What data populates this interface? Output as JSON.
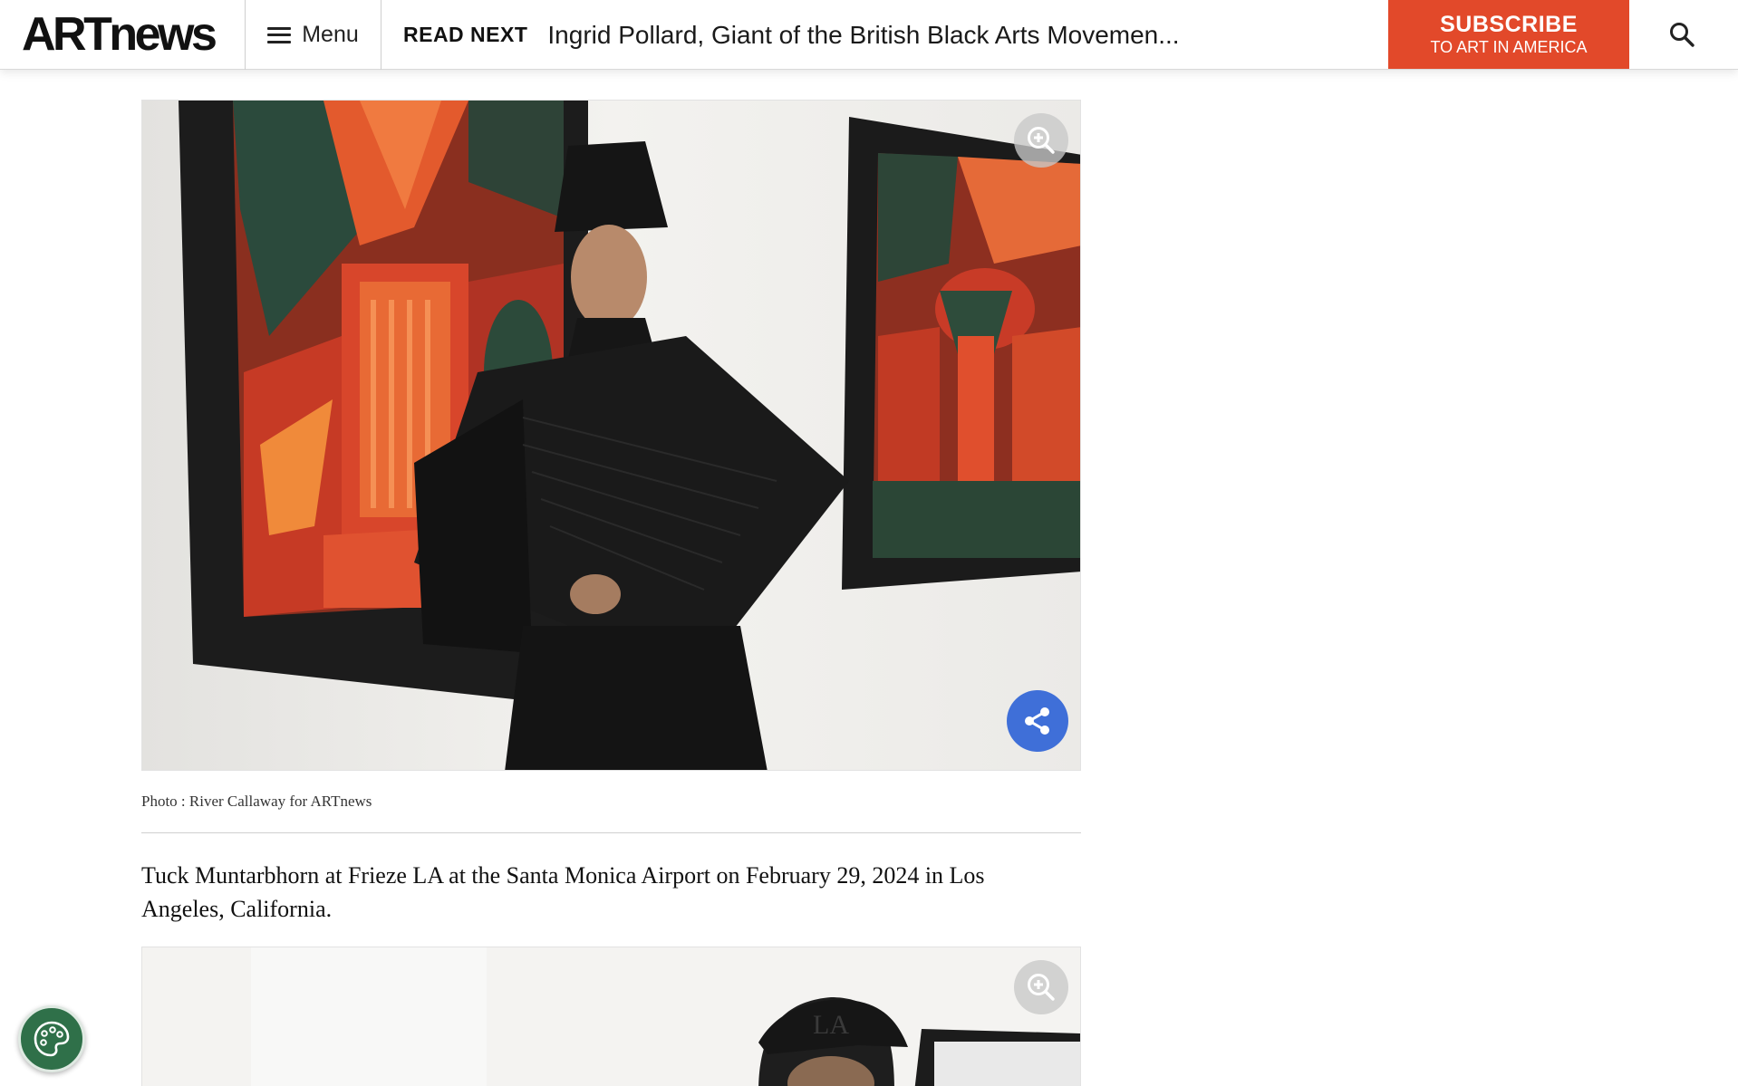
{
  "header": {
    "logo_text": "ARTnews",
    "menu_label": "Menu",
    "read_next_tag": "READ NEXT",
    "read_next_headline": "Ingrid Pollard, Giant of the British Black Arts Movemen...",
    "subscribe_title": "SUBSCRIBE",
    "subscribe_subtitle": "TO ART IN AMERICA",
    "search_icon": "search-icon"
  },
  "article": {
    "photo_credit": "Photo : River Callaway for ARTnews",
    "caption": "Tuck Muntarbhorn at Frieze LA at the Santa Monica Airport on February 29, 2024 in Los Angeles, California.",
    "zoom_icon": "zoom-in-icon",
    "share_icon": "share-icon"
  },
  "cookie_widget": {
    "icon": "cookie-palette-icon"
  },
  "colors": {
    "subscribe_bg": "#e2492a",
    "share_bg": "#3f6fd8",
    "cookie_bg": "#2f7049"
  }
}
